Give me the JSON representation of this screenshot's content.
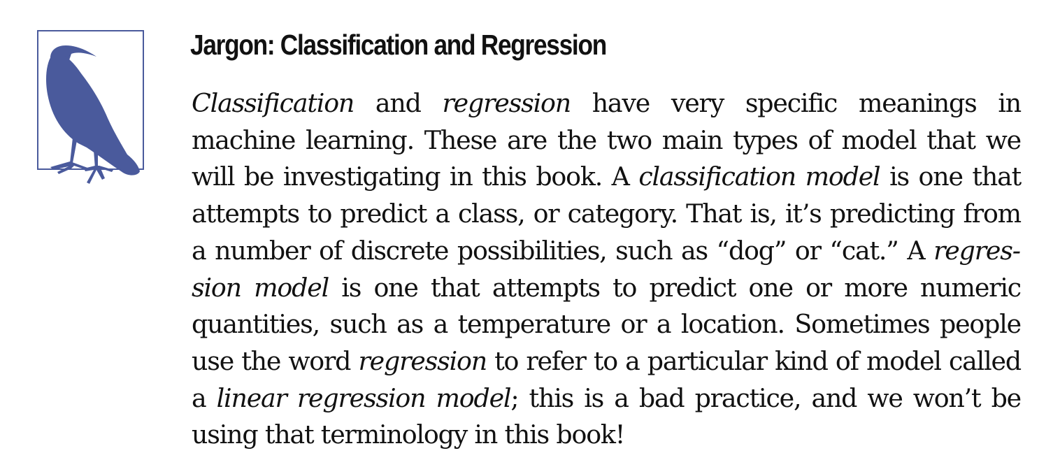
{
  "sidebar": {
    "icon": "crow-icon",
    "accent_color": "#4a5a9c",
    "heading": "Jargon: Classification and Regression",
    "paragraph": [
      {
        "text": "Classification",
        "italic": true
      },
      {
        "text": " and ",
        "italic": false
      },
      {
        "text": "regression",
        "italic": true
      },
      {
        "text": " have very specific meanings in machine learning. These are the two main types of model that we will be investigating in this book. A ",
        "italic": false
      },
      {
        "text": "classification model",
        "italic": true
      },
      {
        "text": " is one that attempts to predict a class, or category. That is, it’s predicting from a number of discrete possibilities, such as “dog” or “cat.” A ",
        "italic": false
      },
      {
        "text": "regres­sion model",
        "italic": true
      },
      {
        "text": " is one that attempts to predict one or more numeric quantities, such as a temperature or a location. Sometimes people use the word ",
        "italic": false
      },
      {
        "text": "regression",
        "italic": true
      },
      {
        "text": " to refer to a particular kind of model called a ",
        "italic": false
      },
      {
        "text": "linear regression model",
        "italic": true
      },
      {
        "text": "; this is a bad practice, and we won’t be using that terminology in this book!",
        "italic": false
      }
    ]
  }
}
